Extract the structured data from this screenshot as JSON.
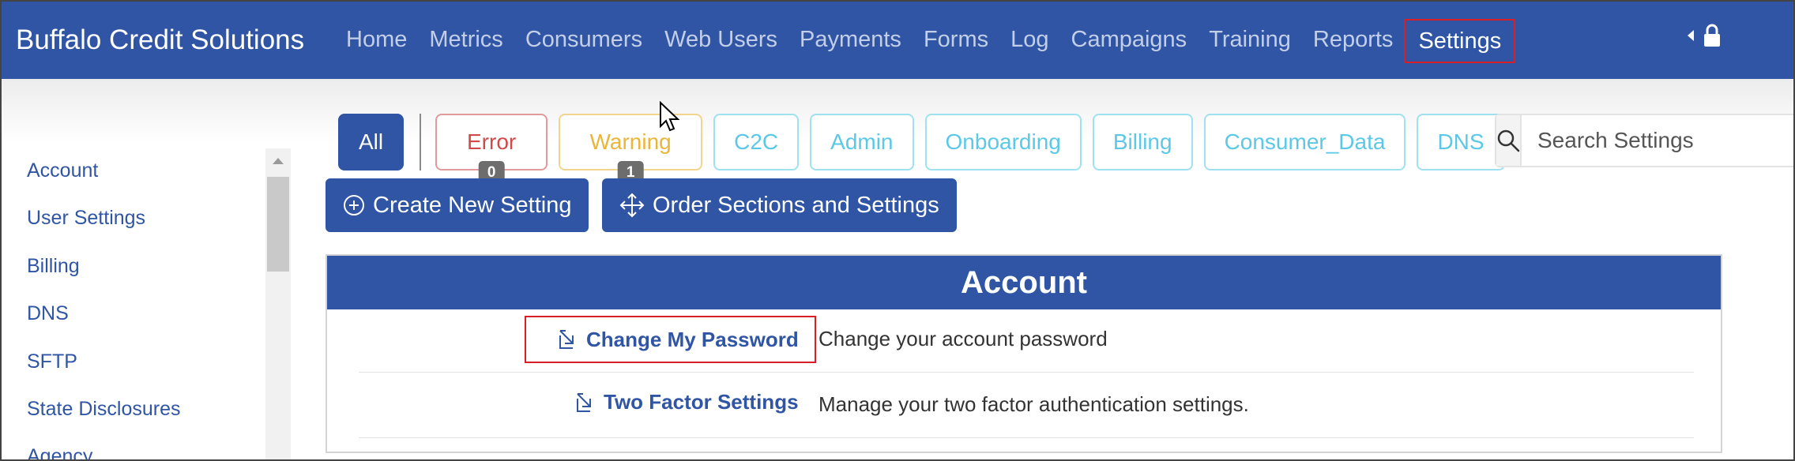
{
  "brand": "Buffalo Credit Solutions",
  "nav": {
    "items": [
      "Home",
      "Metrics",
      "Consumers",
      "Web Users",
      "Payments",
      "Forms",
      "Log",
      "Campaigns",
      "Training",
      "Reports"
    ],
    "active": "Settings"
  },
  "sidebar": {
    "items": [
      "Account",
      "User Settings",
      "Billing",
      "DNS",
      "SFTP",
      "State Disclosures",
      "Agency"
    ]
  },
  "filters": {
    "all": "All",
    "error": {
      "label": "Error",
      "count": "0"
    },
    "warning": {
      "label": "Warning",
      "count": "1"
    },
    "tags": [
      "C2C",
      "Admin",
      "Onboarding",
      "Billing",
      "Consumer_Data",
      "DNS"
    ]
  },
  "search": {
    "placeholder": "Search Settings",
    "icon": "search-icon"
  },
  "actions": {
    "create": "Create New Setting",
    "order": "Order Sections and Settings"
  },
  "section": {
    "title": "Account",
    "rows": [
      {
        "label": "Change My Password",
        "description": "Change your account password"
      },
      {
        "label": "Two Factor Settings",
        "description": "Manage your two factor authentication settings."
      }
    ]
  },
  "colors": {
    "primary": "#2f55a4",
    "highlight": "#d81f26",
    "error": "#d14a4a",
    "warning": "#e9b53a",
    "tag": "#5bc8e8"
  }
}
